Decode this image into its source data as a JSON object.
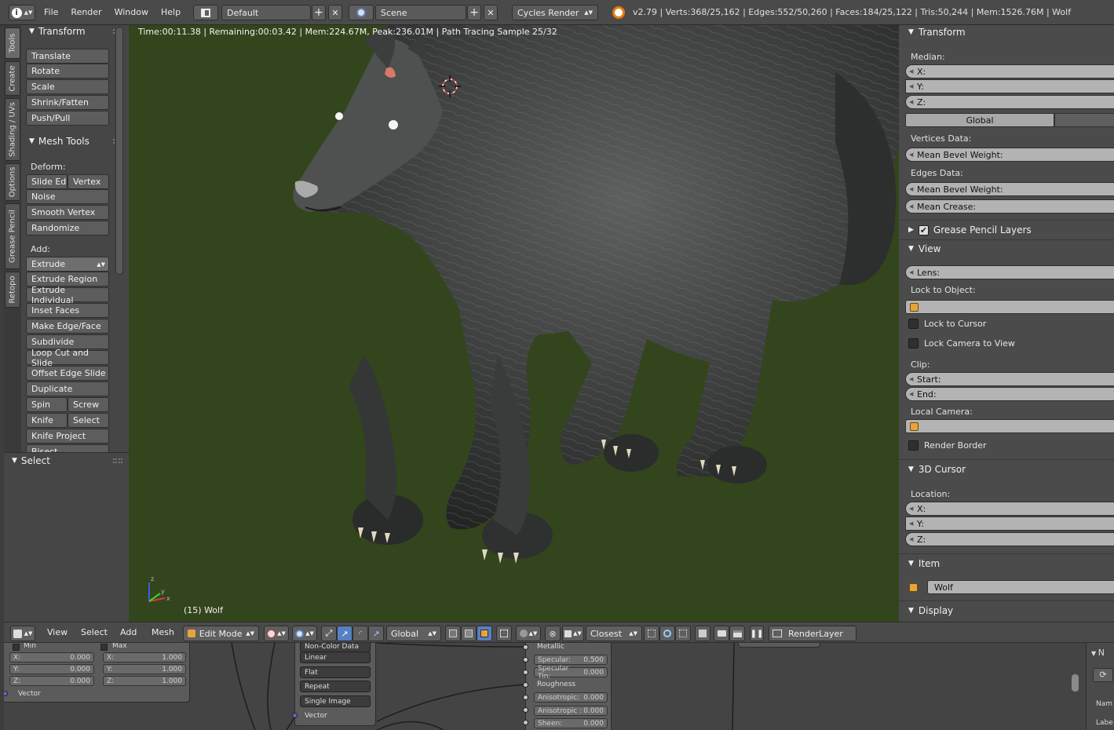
{
  "topbar": {
    "menus": [
      "File",
      "Render",
      "Window",
      "Help"
    ],
    "screen_layout": "Default",
    "scene": "Scene",
    "render_engine": "Cycles Render",
    "stats": "v2.79 | Verts:368/25,162 | Edges:552/50,260 | Faces:184/25,122 | Tris:50,244 | Mem:1526.76M | Wolf"
  },
  "tool_tabs": [
    "Tools",
    "Create",
    "Shading / UVs",
    "Options",
    "Grease Pencil",
    "Retopo"
  ],
  "tool_shelf": {
    "transform": {
      "title": "Transform",
      "buttons": [
        "Translate",
        "Rotate",
        "Scale",
        "Shrink/Fatten",
        "Push/Pull"
      ]
    },
    "mesh_tools": {
      "title": "Mesh Tools",
      "deform_label": "Deform:",
      "slide_edge": "Slide Ed",
      "vertex": "Vertex",
      "deform_buttons": [
        "Noise",
        "Smooth Vertex",
        "Randomize"
      ],
      "add_label": "Add:",
      "extrude": "Extrude",
      "add_buttons": [
        "Extrude Region",
        "Extrude Individual",
        "Inset Faces",
        "Make Edge/Face",
        "Subdivide",
        "Loop Cut and Slide",
        "Offset Edge Slide",
        "Duplicate"
      ],
      "spin": "Spin",
      "screw": "Screw",
      "knife": "Knife",
      "select": "Select",
      "knife_project": "Knife Project",
      "bisect": "Bisect"
    },
    "select_panel": "Select"
  },
  "viewport": {
    "render_info": "Time:00:11.38 | Remaining:00:03.42 | Mem:224.67M, Peak:236.01M | Path Tracing Sample 25/32",
    "object_label": "(15) Wolf"
  },
  "properties": {
    "transform": "Transform",
    "median": "Median:",
    "x": "X:",
    "y": "Y:",
    "z": "Z:",
    "global": "Global",
    "vertices_data": "Vertices Data:",
    "mean_bevel_weight": "Mean Bevel Weight:",
    "edges_data": "Edges Data:",
    "mean_crease": "Mean Crease:",
    "grease_pencil_layers": "Grease Pencil Layers",
    "view": "View",
    "lens": "Lens:",
    "lock_to_object": "Lock to Object:",
    "lock_to_cursor": "Lock to Cursor",
    "lock_camera_to_view": "Lock Camera to View",
    "clip": "Clip:",
    "start": "Start:",
    "end": "End:",
    "local_camera": "Local Camera:",
    "render_border": "Render Border",
    "cursor_3d": "3D Cursor",
    "location": "Location:",
    "item": "Item",
    "item_name": "Wolf",
    "display": "Display"
  },
  "view_header": {
    "menus": [
      "View",
      "Select",
      "Add",
      "Mesh"
    ],
    "mode": "Edit Mode",
    "orientation": "Global",
    "snap": "Closest",
    "render_layer": "RenderLayer"
  },
  "node_editor": {
    "min": "Min",
    "max": "Max",
    "min_x": "0.000",
    "min_y": "0.000",
    "min_z": "0.000",
    "max_x": "1.000",
    "max_y": "1.000",
    "max_z": "1.000",
    "vector_out": "Vector",
    "color_space": "Non-Color Data",
    "interp": "Linear",
    "projection": "Flat",
    "extension": "Repeat",
    "source": "Single Image",
    "vector_in": "Vector",
    "metallic": "Metallic",
    "specular": "Specular:",
    "specular_val": "0.500",
    "specular_tint": "Specular Tin:",
    "specular_tint_val": "0.000",
    "roughness": "Roughness",
    "aniso1": "Anisotropic:",
    "aniso1_val": "0.000",
    "aniso2": "Anisotropic :",
    "aniso2_val": "0.000",
    "sheen": "Sheen:",
    "sheen_val": "0.000",
    "right_n": "N",
    "right_name": "Nam",
    "right_label": "Labe"
  },
  "colors": {
    "viewport_bg": "#33451c",
    "accent_blue": "#5680c2",
    "cube_orange": "#e8a43c"
  }
}
